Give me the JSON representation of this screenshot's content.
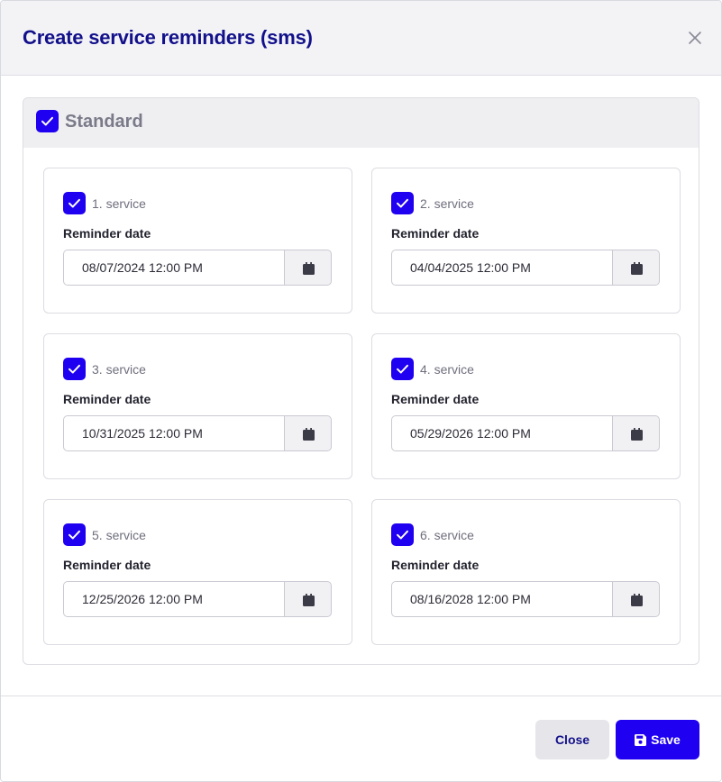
{
  "modal": {
    "title": "Create service reminders (sms)",
    "close_icon": "close-icon"
  },
  "section": {
    "title": "Standard",
    "checked": true
  },
  "services": [
    {
      "label": "1. service",
      "checked": true,
      "reminder_label": "Reminder date",
      "date": "08/07/2024 12:00 PM"
    },
    {
      "label": "2. service",
      "checked": true,
      "reminder_label": "Reminder date",
      "date": "04/04/2025 12:00 PM"
    },
    {
      "label": "3. service",
      "checked": true,
      "reminder_label": "Reminder date",
      "date": "10/31/2025 12:00 PM"
    },
    {
      "label": "4. service",
      "checked": true,
      "reminder_label": "Reminder date",
      "date": "05/29/2026 12:00 PM"
    },
    {
      "label": "5. service",
      "checked": true,
      "reminder_label": "Reminder date",
      "date": "12/25/2026 12:00 PM"
    },
    {
      "label": "6. service",
      "checked": true,
      "reminder_label": "Reminder date",
      "date": "08/16/2028 12:00 PM"
    }
  ],
  "footer": {
    "close_label": "Close",
    "save_label": "Save",
    "save_icon": "floppy-disk-icon"
  },
  "colors": {
    "accent": "#1f00f0",
    "title": "#12108a",
    "header_bg": "#f3f3f6"
  }
}
